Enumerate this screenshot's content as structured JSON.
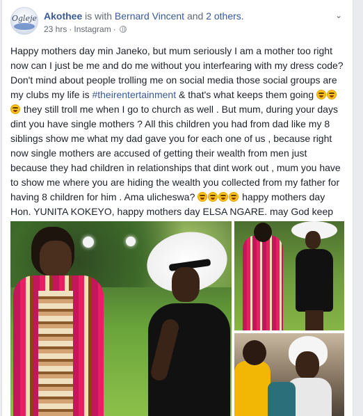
{
  "post": {
    "author": "Akothee",
    "with_text": "is with",
    "tagged_person": "Bernard Vincent",
    "and_text": "and",
    "others": "2 others.",
    "time": "23 hrs",
    "source": "Instagram",
    "avatar_text": "Ogleje",
    "text_parts": {
      "p1": "Happy mothers day min Janeko, but mum seriously I am a mother too right now can I just be me and do me without you interfearing with my dress code? Don't mind about people trolling me on social media those social groups are my clubs my life is ",
      "hashtag": "#theirentertainment",
      "p2": " & that's what keeps them going ",
      "p3": " they still troll me when I go to church as well . But mum, during your days dint you have single mothers ? All this children you had from dad like my 8 siblings show me what my dad gave you for each one of us , because right now single mothers are accused of getting their wealth from men just because they had children in relationships that dint work out , mum you have to show me where you are hiding the wealth you collected from my father for having 8 children for him . Ama ulicheswa? ",
      "p4": " happy mothers day Hon. YUNITA KOKEYO, happy mothers day ELSA NGARE. may God keep you bless you I LOVE YOU SOO MUCH"
    }
  },
  "icons": {
    "globe": "globe-icon",
    "chevron": "chevron-down-icon",
    "emoji": "grinning-face-icon"
  },
  "colors": {
    "link": "#385898",
    "meta": "#616770",
    "text": "#1d2129",
    "background": "#e9ebee"
  }
}
